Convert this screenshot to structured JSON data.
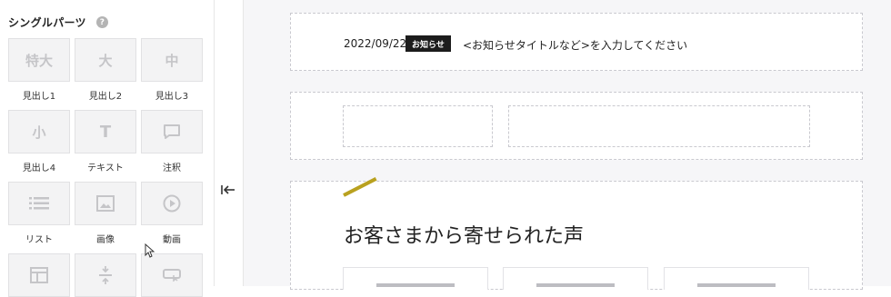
{
  "sidebar": {
    "title": "シングルパーツ",
    "help_icon": "question-circle-icon",
    "parts": [
      {
        "label": "見出し1",
        "icon": "heading-xl-icon",
        "glyph": "特大"
      },
      {
        "label": "見出し2",
        "icon": "heading-l-icon",
        "glyph": "大"
      },
      {
        "label": "見出し3",
        "icon": "heading-m-icon",
        "glyph": "中"
      },
      {
        "label": "見出し4",
        "icon": "heading-s-icon",
        "glyph": "小"
      },
      {
        "label": "テキスト",
        "icon": "text-icon",
        "glyph": "T"
      },
      {
        "label": "注釈",
        "icon": "annotation-icon",
        "glyph": ""
      },
      {
        "label": "リスト",
        "icon": "list-icon",
        "glyph": ""
      },
      {
        "label": "画像",
        "icon": "image-icon",
        "glyph": ""
      },
      {
        "label": "動画",
        "icon": "video-icon",
        "glyph": ""
      },
      {
        "label": "",
        "icon": "table-icon",
        "glyph": ""
      },
      {
        "label": "",
        "icon": "spacer-icon",
        "glyph": ""
      },
      {
        "label": "",
        "icon": "button-icon",
        "glyph": ""
      }
    ]
  },
  "collapse_icon": "collapse-left-icon",
  "news": {
    "date": "2022/09/22",
    "badge": "お知らせ",
    "title": "<お知らせタイトルなど>を入力してください"
  },
  "voice": {
    "heading": "お客さまから寄せられた声",
    "accent_color": "#b9a11f"
  },
  "colors": {
    "canvas_bg": "#f6f6f8",
    "tile_bg": "#f3f3f4",
    "badge_bg": "#1c1c1c"
  }
}
